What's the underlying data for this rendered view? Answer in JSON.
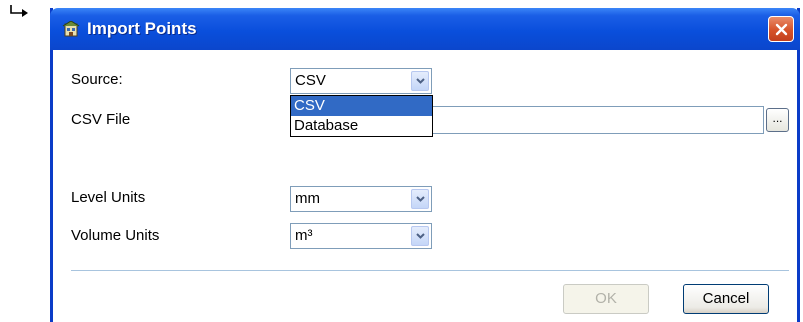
{
  "window": {
    "title": "Import Points",
    "close_icon": "close-icon"
  },
  "form": {
    "source": {
      "label": "Source:",
      "value": "CSV",
      "options": [
        "CSV",
        "Database"
      ],
      "selected_index": 0
    },
    "csv_file": {
      "label": "CSV File",
      "value": "",
      "browse_label": "..."
    },
    "level_units": {
      "label": "Level Units",
      "value": "mm"
    },
    "volume_units": {
      "label": "Volume Units",
      "value": "m³"
    }
  },
  "buttons": {
    "ok": "OK",
    "cancel": "Cancel"
  },
  "colors": {
    "titlebar": "#0a4fdc",
    "selection": "#316ac5",
    "close": "#d6532a"
  }
}
